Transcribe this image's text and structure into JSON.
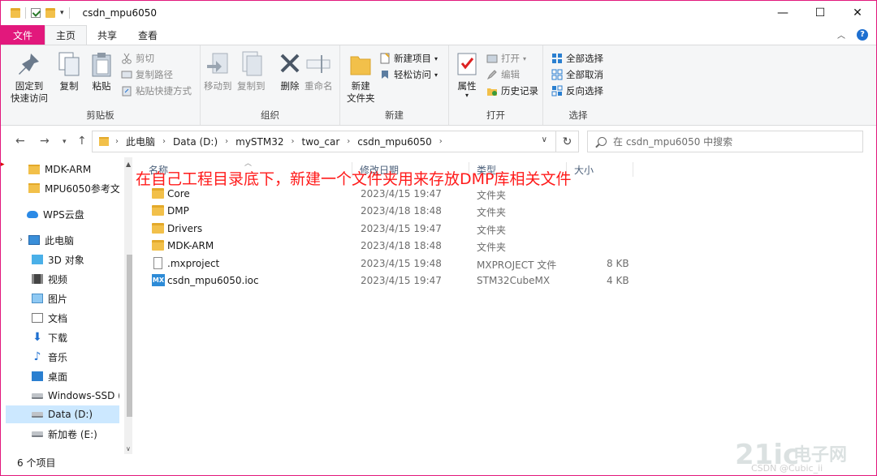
{
  "window": {
    "title": "csdn_mpu6050"
  },
  "window_controls": {
    "minimize": "—",
    "maximize": "☐",
    "close": "✕"
  },
  "tabs": {
    "file": "文件",
    "home": "主页",
    "share": "共享",
    "view": "查看"
  },
  "ribbon": {
    "clipboard": {
      "label": "剪贴板",
      "pin": "固定到\n快速访问",
      "pin_line1": "固定到",
      "pin_line2": "快速访问",
      "copy": "复制",
      "paste": "粘贴",
      "cut": "剪切",
      "copy_path": "复制路径",
      "paste_shortcut": "粘贴快捷方式"
    },
    "organize": {
      "label": "组织",
      "move_to": "移动到",
      "copy_to": "复制到",
      "delete": "删除",
      "rename": "重命名"
    },
    "new": {
      "label": "新建",
      "new_folder_line1": "新建",
      "new_folder_line2": "文件夹",
      "new_item": "新建项目",
      "easy_access": "轻松访问"
    },
    "open": {
      "label": "打开",
      "properties": "属性",
      "open": "打开",
      "edit": "编辑",
      "history": "历史记录"
    },
    "select": {
      "label": "选择",
      "select_all": "全部选择",
      "select_none": "全部取消",
      "invert": "反向选择"
    }
  },
  "address": {
    "crumbs": [
      "此电脑",
      "Data (D:)",
      "mySTM32",
      "two_car",
      "csdn_mpu6050"
    ],
    "search_placeholder": "在 csdn_mpu6050 中搜索"
  },
  "nav_pane": {
    "items": [
      {
        "label": "MDK-ARM",
        "icon": "folder-icon"
      },
      {
        "label": "MPU6050参考文",
        "icon": "folder-icon"
      },
      {
        "label": "WPS云盘",
        "icon": "cloud-icon"
      },
      {
        "label": "此电脑",
        "icon": "computer-icon"
      },
      {
        "label": "3D 对象",
        "icon": "cube-icon"
      },
      {
        "label": "视频",
        "icon": "video-icon"
      },
      {
        "label": "图片",
        "icon": "picture-icon"
      },
      {
        "label": "文档",
        "icon": "document-icon"
      },
      {
        "label": "下载",
        "icon": "download-icon"
      },
      {
        "label": "音乐",
        "icon": "music-icon"
      },
      {
        "label": "桌面",
        "icon": "desktop-icon"
      },
      {
        "label": "Windows-SSD (",
        "icon": "drive-icon"
      },
      {
        "label": "Data (D:)",
        "icon": "drive-icon"
      },
      {
        "label": "新加卷 (E:)",
        "icon": "drive-icon"
      }
    ]
  },
  "columns": {
    "name": "名称",
    "modified": "修改日期",
    "type": "类型",
    "size": "大小"
  },
  "files": [
    {
      "name": "Core",
      "modified": "2023/4/15 19:47",
      "type": "文件夹",
      "size": "",
      "icon": "folder-icon"
    },
    {
      "name": "DMP",
      "modified": "2023/4/18 18:48",
      "type": "文件夹",
      "size": "",
      "icon": "folder-icon"
    },
    {
      "name": "Drivers",
      "modified": "2023/4/15 19:47",
      "type": "文件夹",
      "size": "",
      "icon": "folder-icon"
    },
    {
      "name": "MDK-ARM",
      "modified": "2023/4/18 18:48",
      "type": "文件夹",
      "size": "",
      "icon": "folder-icon"
    },
    {
      "name": ".mxproject",
      "modified": "2023/4/15 19:48",
      "type": "MXPROJECT 文件",
      "size": "8 KB",
      "icon": "file-icon"
    },
    {
      "name": "csdn_mpu6050.ioc",
      "modified": "2023/4/15 19:47",
      "type": "STM32CubeMX",
      "size": "4 KB",
      "icon": "mx-icon"
    }
  ],
  "annotation": "在自己工程目录底下，新建一个文件夹用来存放DMP库相关文件",
  "status": {
    "count": "6 个项目"
  },
  "watermark": {
    "brand": "21ic",
    "site": "电子网",
    "caption": "CSDN @Cubic_ii"
  },
  "colors": {
    "accent": "#e2187c",
    "folder": "#f2c04a",
    "annotation": "#ff1a1a",
    "selection": "#cce8ff"
  }
}
